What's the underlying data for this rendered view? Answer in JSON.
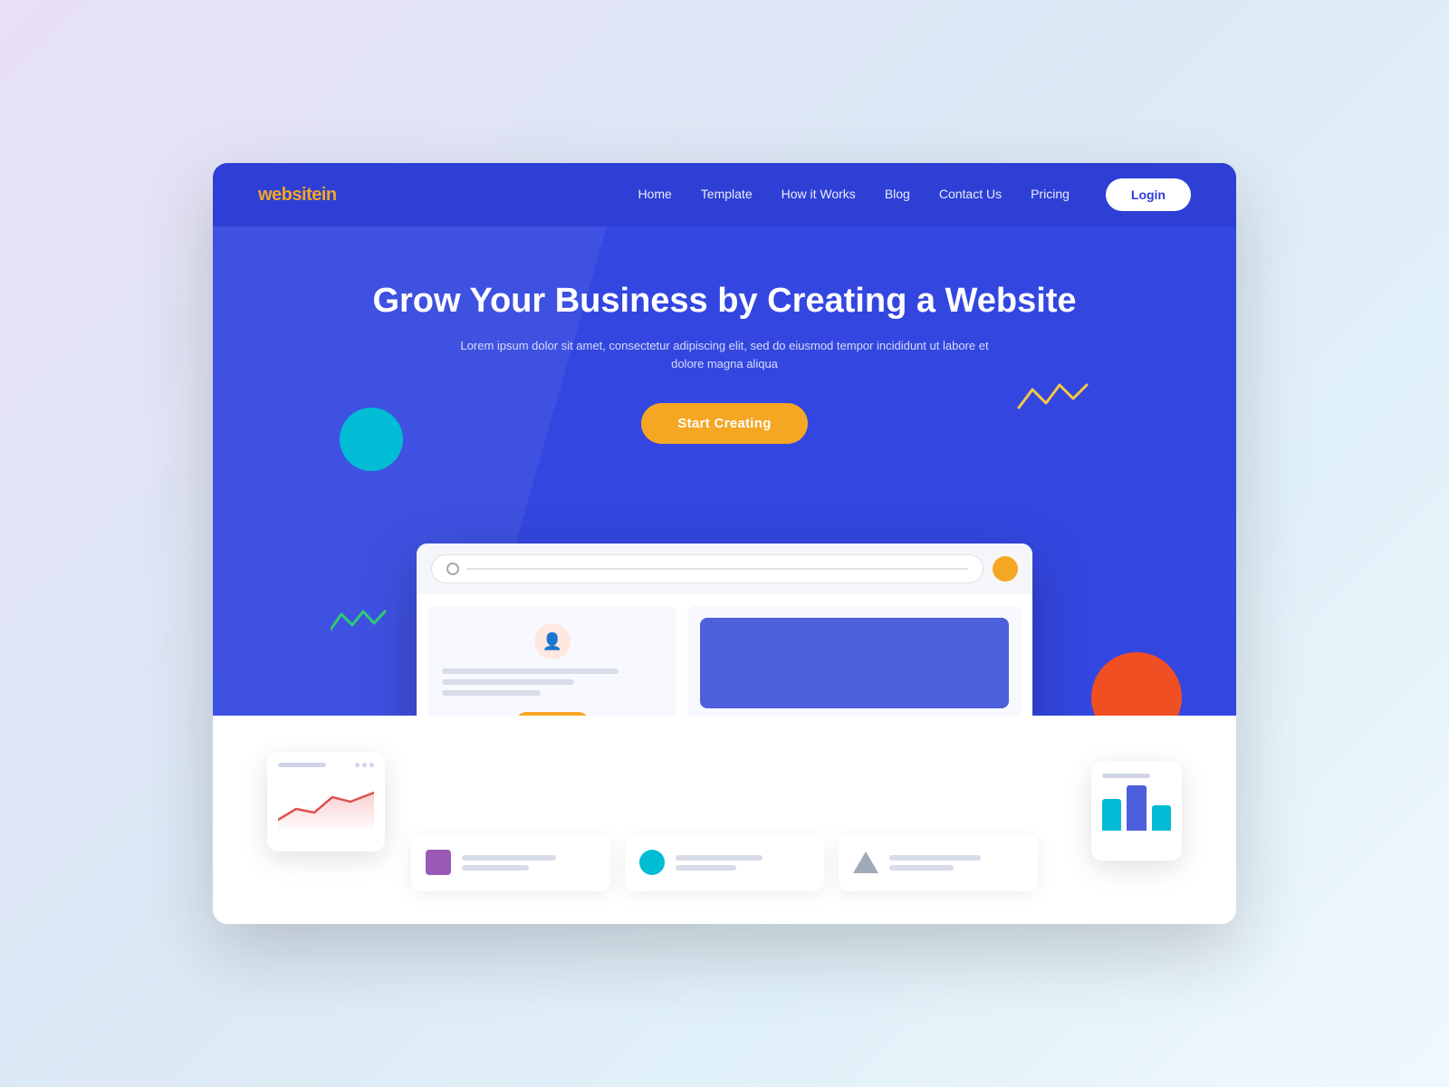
{
  "logo": {
    "text_main": "website",
    "text_accent": "in"
  },
  "navbar": {
    "links": [
      {
        "label": "Home",
        "id": "home"
      },
      {
        "label": "Template",
        "id": "template"
      },
      {
        "label": "How it Works",
        "id": "how-it-works"
      },
      {
        "label": "Blog",
        "id": "blog"
      },
      {
        "label": "Contact Us",
        "id": "contact"
      },
      {
        "label": "Pricing",
        "id": "pricing"
      }
    ],
    "login_label": "Login"
  },
  "hero": {
    "title": "Grow Your Business by Creating a Website",
    "subtitle": "Lorem ipsum dolor sit amet, consectetur adipiscing elit, sed do eiusmod tempor incididunt ut labore et dolore magna aliqua",
    "cta_label": "Start Creating"
  },
  "bottom_cards": [
    {
      "icon_type": "square-purple",
      "line1_width": "70%",
      "line2_width": "50%"
    },
    {
      "icon_type": "circle-teal",
      "line1_width": "65%",
      "line2_width": "45%"
    },
    {
      "icon_type": "triangle-gray",
      "line1_width": "68%",
      "line2_width": "48%"
    }
  ],
  "colors": {
    "hero_bg": "#3347e0",
    "navbar_bg": "#2d3fd4",
    "cta_yellow": "#f5a623",
    "cyan": "#00bcd4",
    "orange": "#f04e23",
    "accent_blue": "#4d5fdb"
  }
}
